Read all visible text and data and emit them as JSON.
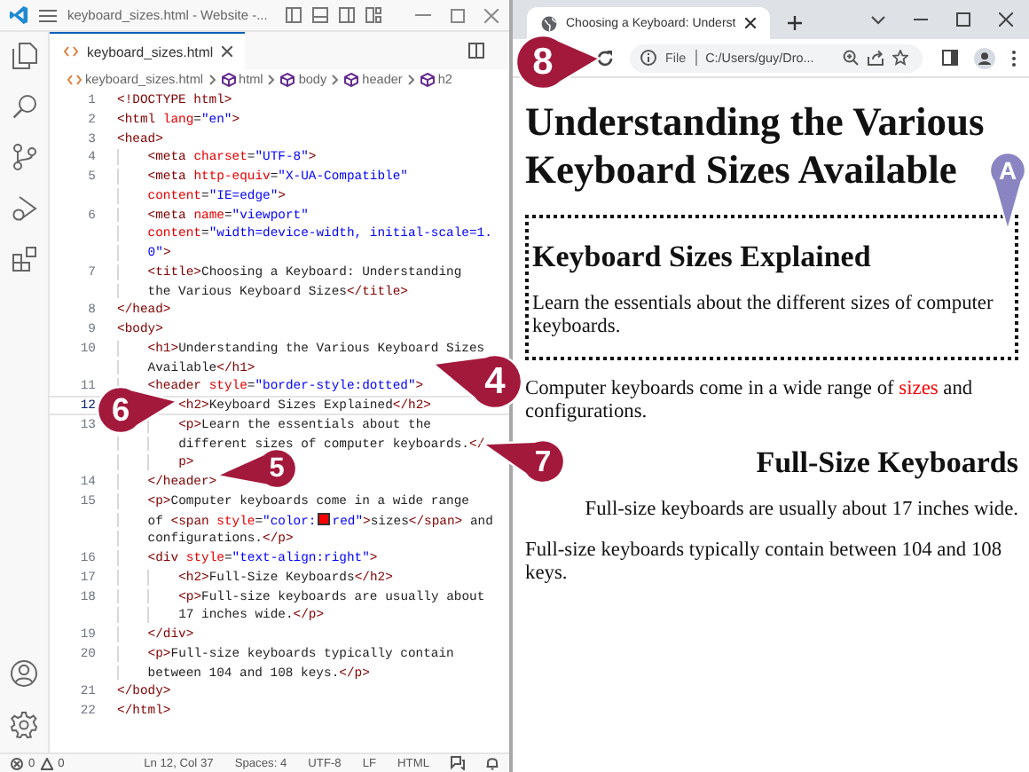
{
  "editor": {
    "title": "keyboard_sizes.html - Website -...",
    "tabs": [
      {
        "label": "keyboard_sizes.html",
        "selected": true
      }
    ],
    "breadcrumbs": [
      {
        "kind": "file",
        "label": "keyboard_sizes.html"
      },
      {
        "kind": "element",
        "label": "html"
      },
      {
        "kind": "element",
        "label": "body"
      },
      {
        "kind": "element",
        "label": "header"
      },
      {
        "kind": "element",
        "label": "h2"
      }
    ],
    "lines": [
      {
        "line": "1",
        "current": false,
        "rows": [
          {
            "tokens": [
              {
                "kind": "tag",
                "text": "<!DOCTYPE html>"
              }
            ]
          }
        ]
      },
      {
        "line": "2",
        "current": false,
        "rows": [
          {
            "tokens": [
              {
                "kind": "tag",
                "text": "<html"
              },
              {
                "kind": "attr",
                "text": " lang"
              },
              {
                "kind": "text",
                "text": "="
              },
              {
                "kind": "value",
                "text": "\"en\""
              },
              {
                "kind": "tag",
                "text": ">"
              }
            ]
          }
        ]
      },
      {
        "line": "3",
        "current": false,
        "rows": [
          {
            "tokens": [
              {
                "kind": "tag",
                "text": "<head>"
              }
            ]
          }
        ],
        "children": [
          {
            "line": "4",
            "current": false,
            "rows": [
              {
                "tokens": [
                  {
                    "kind": "tag",
                    "text": "<meta"
                  },
                  {
                    "kind": "attr",
                    "text": " charset"
                  },
                  {
                    "kind": "text",
                    "text": "="
                  },
                  {
                    "kind": "value",
                    "text": "\"UTF-8\""
                  },
                  {
                    "kind": "tag",
                    "text": ">"
                  }
                ]
              }
            ]
          },
          {
            "line": "5",
            "current": false,
            "rows": [
              {
                "tokens": [
                  {
                    "kind": "tag",
                    "text": "<meta"
                  },
                  {
                    "kind": "attr",
                    "text": " http-equiv"
                  },
                  {
                    "kind": "text",
                    "text": "="
                  },
                  {
                    "kind": "value",
                    "text": "\"X-UA-Compatible\""
                  }
                ]
              },
              {
                "tokens": [
                  {
                    "kind": "attr",
                    "text": "content"
                  },
                  {
                    "kind": "text",
                    "text": "="
                  },
                  {
                    "kind": "value",
                    "text": "\"IE=edge\""
                  },
                  {
                    "kind": "tag",
                    "text": ">"
                  }
                ]
              }
            ]
          },
          {
            "line": "6",
            "current": false,
            "rows": [
              {
                "tokens": [
                  {
                    "kind": "tag",
                    "text": "<meta"
                  },
                  {
                    "kind": "attr",
                    "text": " name"
                  },
                  {
                    "kind": "text",
                    "text": "="
                  },
                  {
                    "kind": "value",
                    "text": "\"viewport\""
                  }
                ]
              },
              {
                "tokens": [
                  {
                    "kind": "attr",
                    "text": "content"
                  },
                  {
                    "kind": "text",
                    "text": "="
                  },
                  {
                    "kind": "value",
                    "text": "\"width=device-width, initial-scale=1."
                  }
                ]
              },
              {
                "tokens": [
                  {
                    "kind": "value",
                    "text": "0\""
                  },
                  {
                    "kind": "tag",
                    "text": ">"
                  }
                ]
              }
            ]
          },
          {
            "line": "7",
            "current": false,
            "rows": [
              {
                "tokens": [
                  {
                    "kind": "tag",
                    "text": "<title>"
                  },
                  {
                    "kind": "text",
                    "text": "Choosing a Keyboard: Understanding"
                  }
                ]
              },
              {
                "tokens": [
                  {
                    "kind": "text",
                    "text": "the Various Keyboard Sizes"
                  },
                  {
                    "kind": "tag",
                    "text": "</title>"
                  }
                ]
              }
            ]
          }
        ]
      },
      {
        "line": "8",
        "current": false,
        "rows": [
          {
            "tokens": [
              {
                "kind": "tag",
                "text": "</head>"
              }
            ]
          }
        ]
      },
      {
        "line": "9",
        "current": false,
        "rows": [
          {
            "tokens": [
              {
                "kind": "tag",
                "text": "<body>"
              }
            ]
          }
        ],
        "children": [
          {
            "line": "10",
            "current": false,
            "rows": [
              {
                "tokens": [
                  {
                    "kind": "tag",
                    "text": "<h1>"
                  },
                  {
                    "kind": "text",
                    "text": "Understanding the Various Keyboard Sizes"
                  }
                ]
              },
              {
                "tokens": [
                  {
                    "kind": "text",
                    "text": "Available"
                  },
                  {
                    "kind": "tag",
                    "text": "</h1>"
                  }
                ]
              }
            ]
          },
          {
            "line": "11",
            "current": false,
            "rows": [
              {
                "tokens": [
                  {
                    "kind": "tag",
                    "text": "<header"
                  },
                  {
                    "kind": "attr",
                    "text": " style"
                  },
                  {
                    "kind": "text",
                    "text": "="
                  },
                  {
                    "kind": "value",
                    "text": "\"border-style:dotted\""
                  },
                  {
                    "kind": "tag",
                    "text": ">"
                  }
                ]
              }
            ],
            "children": [
              {
                "line": "12",
                "current": true,
                "rows": [
                  {
                    "tokens": [
                      {
                        "kind": "tag",
                        "text": "<h2>"
                      },
                      {
                        "kind": "text",
                        "text": "Keyboard Sizes Explained"
                      },
                      {
                        "kind": "tag",
                        "text": "</h2>"
                      }
                    ]
                  }
                ]
              },
              {
                "line": "13",
                "current": false,
                "rows": [
                  {
                    "tokens": [
                      {
                        "kind": "tag",
                        "text": "<p>"
                      },
                      {
                        "kind": "text",
                        "text": "Learn the essentials about the"
                      }
                    ]
                  },
                  {
                    "tokens": [
                      {
                        "kind": "text",
                        "text": "different sizes of computer keyboards."
                      },
                      {
                        "kind": "tag",
                        "text": "</"
                      }
                    ]
                  },
                  {
                    "tokens": [
                      {
                        "kind": "tag",
                        "text": "p>"
                      }
                    ]
                  }
                ]
              }
            ]
          },
          {
            "line": "14",
            "current": false,
            "rows": [
              {
                "tokens": [
                  {
                    "kind": "tag",
                    "text": "</header>"
                  }
                ]
              }
            ]
          },
          {
            "line": "15",
            "current": false,
            "rows": [
              {
                "tokens": [
                  {
                    "kind": "tag",
                    "text": "<p>"
                  },
                  {
                    "kind": "text",
                    "text": "Computer keyboards come in a wide range"
                  }
                ]
              },
              {
                "tokens": [
                  {
                    "kind": "text",
                    "text": "of "
                  },
                  {
                    "kind": "tag",
                    "text": "<span"
                  },
                  {
                    "kind": "attr",
                    "text": " style"
                  },
                  {
                    "kind": "text",
                    "text": "="
                  },
                  {
                    "kind": "value",
                    "text": "\"color:"
                  },
                  {
                    "kind": "swatch",
                    "color": "#ff0000"
                  },
                  {
                    "kind": "value",
                    "text": "red\""
                  },
                  {
                    "kind": "tag",
                    "text": ">"
                  },
                  {
                    "kind": "text",
                    "text": "sizes"
                  },
                  {
                    "kind": "tag",
                    "text": "</span>"
                  },
                  {
                    "kind": "text",
                    "text": " and"
                  }
                ]
              },
              {
                "tokens": [
                  {
                    "kind": "text",
                    "text": "configurations."
                  },
                  {
                    "kind": "tag",
                    "text": "</p>"
                  }
                ]
              }
            ]
          },
          {
            "line": "16",
            "current": false,
            "rows": [
              {
                "tokens": [
                  {
                    "kind": "tag",
                    "text": "<div"
                  },
                  {
                    "kind": "attr",
                    "text": " style"
                  },
                  {
                    "kind": "text",
                    "text": "="
                  },
                  {
                    "kind": "value",
                    "text": "\"text-align:right\""
                  },
                  {
                    "kind": "tag",
                    "text": ">"
                  }
                ]
              }
            ],
            "children": [
              {
                "line": "17",
                "current": false,
                "rows": [
                  {
                    "tokens": [
                      {
                        "kind": "tag",
                        "text": "<h2>"
                      },
                      {
                        "kind": "text",
                        "text": "Full-Size Keyboards"
                      },
                      {
                        "kind": "tag",
                        "text": "</h2>"
                      }
                    ]
                  }
                ]
              },
              {
                "line": "18",
                "current": false,
                "rows": [
                  {
                    "tokens": [
                      {
                        "kind": "tag",
                        "text": "<p>"
                      },
                      {
                        "kind": "text",
                        "text": "Full-size keyboards are usually about"
                      }
                    ]
                  },
                  {
                    "tokens": [
                      {
                        "kind": "text",
                        "text": "17 inches wide."
                      },
                      {
                        "kind": "tag",
                        "text": "</p>"
                      }
                    ]
                  }
                ]
              }
            ]
          },
          {
            "line": "19",
            "current": false,
            "rows": [
              {
                "tokens": [
                  {
                    "kind": "tag",
                    "text": "</div>"
                  }
                ]
              }
            ]
          },
          {
            "line": "20",
            "current": false,
            "rows": [
              {
                "tokens": [
                  {
                    "kind": "tag",
                    "text": "<p>"
                  },
                  {
                    "kind": "text",
                    "text": "Full-size keyboards typically contain"
                  }
                ]
              },
              {
                "tokens": [
                  {
                    "kind": "text",
                    "text": "between 104 and 108 keys."
                  },
                  {
                    "kind": "tag",
                    "text": "</p>"
                  }
                ]
              }
            ]
          }
        ]
      },
      {
        "line": "21",
        "current": false,
        "rows": [
          {
            "tokens": [
              {
                "kind": "tag",
                "text": "</body>"
              }
            ]
          }
        ]
      },
      {
        "line": "22",
        "current": false,
        "rows": [
          {
            "tokens": [
              {
                "kind": "tag",
                "text": "</html>"
              }
            ]
          }
        ]
      }
    ],
    "status_bar": {
      "errors": "0",
      "warnings": "0",
      "items": [
        "Ln 12, Col 37",
        "Spaces: 4",
        "UTF-8",
        "LF",
        "HTML"
      ]
    }
  },
  "browser": {
    "tabs": [
      {
        "title": "Choosing a Keyboard: Underst",
        "selected": true
      }
    ],
    "address": {
      "scheme": "File",
      "url": "C:/Users/guy/Dro..."
    },
    "page": [
      {
        "kind": "h1",
        "text": "Understanding the Various Keyboard Sizes Available"
      },
      {
        "kind": "section",
        "bordered": true,
        "right_aligned": false,
        "blocks": [
          {
            "kind": "h2",
            "text": "Keyboard Sizes Explained"
          },
          {
            "kind": "p",
            "parts": [
              {
                "text": "Learn the essentials about the different sizes of computer keyboards."
              }
            ]
          }
        ]
      },
      {
        "kind": "p",
        "parts": [
          {
            "text": "Computer keyboards come in a wide range of "
          },
          {
            "text": "sizes",
            "color": "#ff0000"
          },
          {
            "text": " and configurations."
          }
        ]
      },
      {
        "kind": "section",
        "bordered": false,
        "right_aligned": true,
        "blocks": [
          {
            "kind": "h2",
            "text": "Full-Size Keyboards"
          },
          {
            "kind": "p",
            "parts": [
              {
                "text": "Full-size keyboards are usually about 17 inches wide."
              }
            ]
          }
        ]
      },
      {
        "kind": "p",
        "parts": [
          {
            "text": "Full-size keyboards typically contain between 104 and 108 keys."
          }
        ]
      }
    ]
  },
  "callouts": [
    {
      "label": "8",
      "color": "#a3193c"
    },
    {
      "label": "4",
      "color": "#a3193c"
    },
    {
      "label": "6",
      "color": "#a3193c"
    },
    {
      "label": "5",
      "color": "#a3193c"
    },
    {
      "label": "7",
      "color": "#a3193c"
    },
    {
      "label": "A",
      "color": "#8a85c2"
    }
  ]
}
